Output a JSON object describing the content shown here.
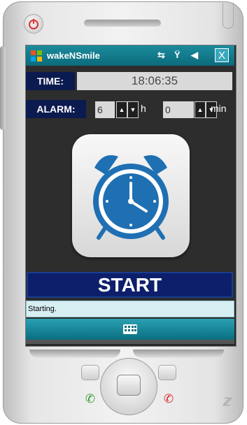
{
  "app": {
    "title": "wakeNSmile"
  },
  "titlebar_icons": [
    "connectivity-icon",
    "signal-icon",
    "volume-icon",
    "close-icon"
  ],
  "titlebar": {
    "close_label": "X"
  },
  "time": {
    "label": "TIME:",
    "value": "18:06:35"
  },
  "alarm": {
    "label": "ALARM:",
    "hours": "6",
    "hours_unit": "h",
    "minutes": "0",
    "minutes_unit": "min"
  },
  "start_button": {
    "label": "START"
  },
  "status": {
    "text": "Starting."
  },
  "colors": {
    "titlebar": "#0b6b7c",
    "label_bg": "#0b1a4f",
    "start_bg": "#0d1f6b",
    "status_bg": "#d7eef2",
    "clock_blue": "#1f6fb3"
  }
}
